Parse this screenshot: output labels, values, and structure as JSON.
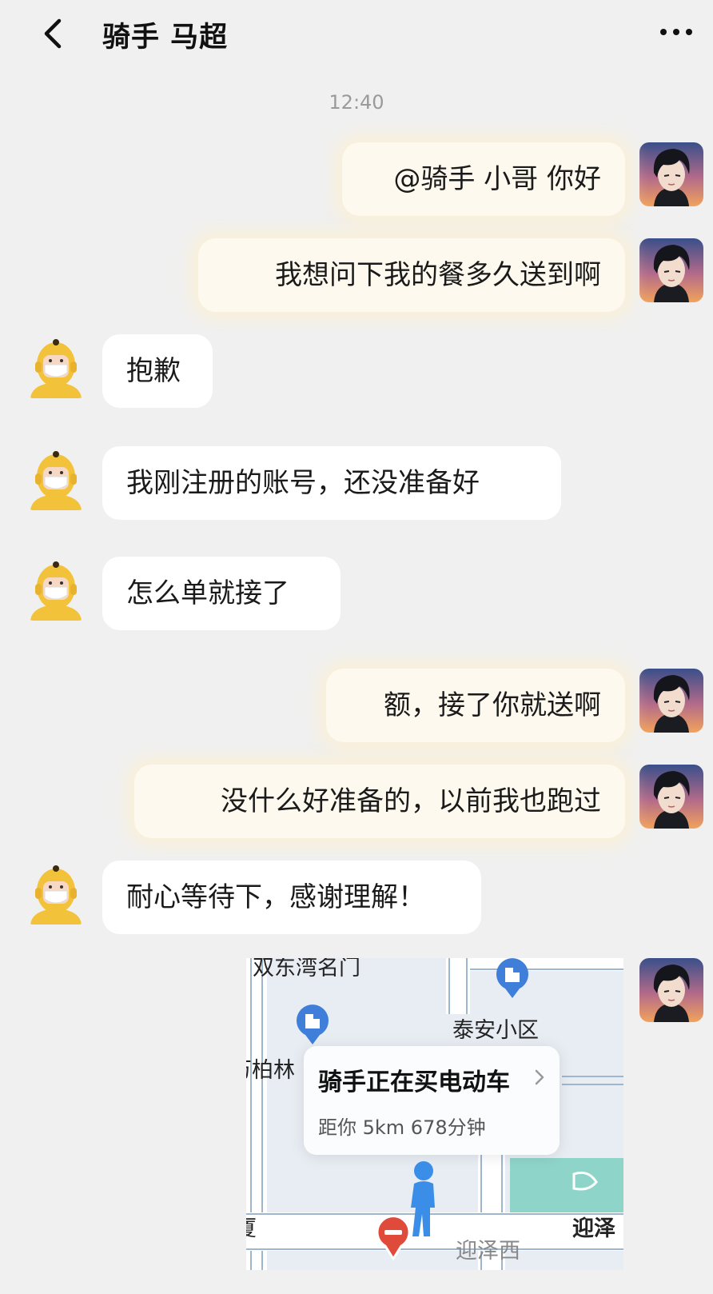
{
  "header": {
    "title": "骑手 马超",
    "back_icon": "chevron-left-icon",
    "more_icon": "more-dots-icon"
  },
  "timestamp": "12:40",
  "messages": [
    {
      "from": "me",
      "text": "@骑手 小哥 你好"
    },
    {
      "from": "me",
      "text": "我想问下我的餐多久送到啊"
    },
    {
      "from": "rider",
      "text": "抱歉"
    },
    {
      "from": "rider",
      "text": "我刚注册的账号，还没准备好"
    },
    {
      "from": "rider",
      "text": "怎么单就接了"
    },
    {
      "from": "me",
      "text": "额，接了你就送啊"
    },
    {
      "from": "me",
      "text": "没什么好准备的，以前我也跑过"
    },
    {
      "from": "rider",
      "text": "耐心等待下，感谢理解！"
    }
  ],
  "map_card": {
    "place_labels": [
      "双东湾名门",
      "泰安小区",
      "万柏林",
      "厦",
      "迎泽西",
      "迎泽"
    ],
    "status_title": "骑手正在买电动车",
    "status_sub": "距你 5km 678分钟",
    "colors": {
      "road": "#ffffff",
      "road_edge": "#9fb6cf",
      "park": "#8fd4c9",
      "poi": "#3f7fd9",
      "marker": "#e04a3a",
      "rider": "#3a8ee8"
    }
  },
  "colors": {
    "background": "#f0f0f0",
    "my_bubble": "#fdf9ee",
    "rider_bubble": "#ffffff",
    "rider_helmet": "#f3c23b"
  }
}
